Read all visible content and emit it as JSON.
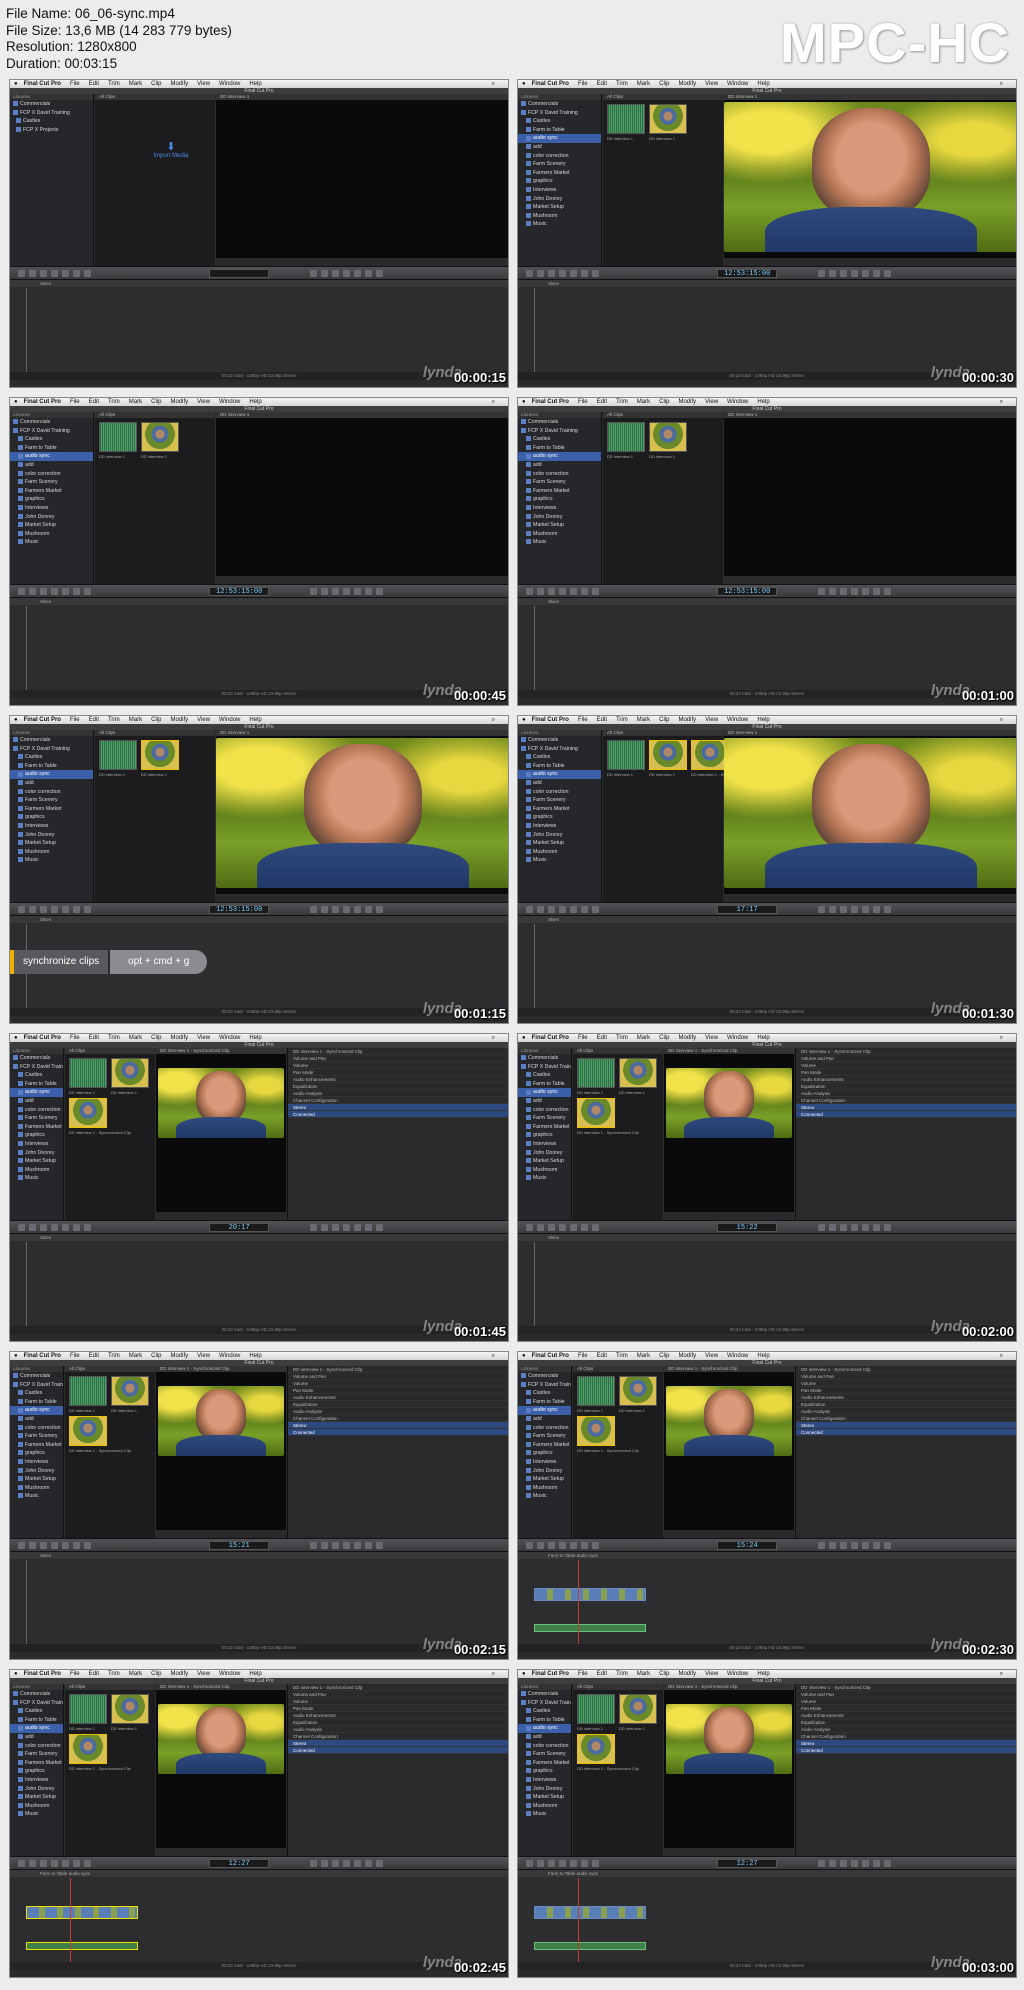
{
  "header": {
    "file_name": "File Name: 06_06-sync.mp4",
    "file_size": "File Size: 13,6 MB (14 283 779 bytes)",
    "resolution": "Resolution: 1280x800",
    "duration": "Duration: 00:03:15",
    "brand": "MPC-HC"
  },
  "app": {
    "menu": [
      "Final Cut Pro",
      "File",
      "Edit",
      "Trim",
      "Mark",
      "Clip",
      "Modify",
      "View",
      "Window",
      "Help"
    ],
    "window_title": "Final Cut Pro",
    "watermark": "lynda"
  },
  "library": {
    "header": "Libraries",
    "items_full": [
      "Commercials",
      "FCP X David Training",
      "Castles",
      "Farm to Table",
      "audio sync",
      "add",
      "color correction",
      "Farm Scenery",
      "Farmers Market",
      "graphics",
      "Interviews",
      "John Doorey",
      "Market Setup",
      "Mushroom",
      "Music"
    ],
    "items_collapsed": [
      "Commercials",
      "FCP X David Training",
      "Castles",
      "FCP X Projects"
    ]
  },
  "browser": {
    "header": "All Clips",
    "import_label": "Import Media",
    "clip_labels": [
      "DD interview 1",
      "DD interview 1",
      "DD interview 1 - Synchronized Clip"
    ]
  },
  "viewer": {
    "header_interview": "DD interview 1",
    "header_sync": "DD interview 1 - Synchronized Clip",
    "header_project": "Farm to Table audio sync"
  },
  "inspector": {
    "rows": [
      "DD interview 1 - Synchronized Clip",
      "Volume and Pan",
      "Volume",
      "Pan Mode",
      "Audio Enhancements",
      "Equalization",
      "Audio Analysis",
      "Channel Configuration",
      "Stereo",
      "Connected"
    ]
  },
  "timeline": {
    "header": "Skies",
    "project": "Farm to Table audio sync",
    "status": "00:22 total - 1080p HD 23.98p Stereo"
  },
  "shortcut": {
    "action": "synchronize clips",
    "keys": "opt + cmd + g"
  },
  "frames": [
    {
      "time": "00:00:15",
      "timecode": ""
    },
    {
      "time": "00:00:30",
      "timecode": "12:53:15:00"
    },
    {
      "time": "00:00:45",
      "timecode": "12:53:15:00"
    },
    {
      "time": "00:01:00",
      "timecode": "12:53:15:00"
    },
    {
      "time": "00:01:15",
      "timecode": "12:53:15:00"
    },
    {
      "time": "00:01:30",
      "timecode": "17:17"
    },
    {
      "time": "00:01:45",
      "timecode": "20:17"
    },
    {
      "time": "00:02:00",
      "timecode": "15:22"
    },
    {
      "time": "00:02:15",
      "timecode": "15:21"
    },
    {
      "time": "00:02:30",
      "timecode": "15:24"
    },
    {
      "time": "00:02:45",
      "timecode": "12:27"
    },
    {
      "time": "00:03:00",
      "timecode": "12:27"
    }
  ]
}
